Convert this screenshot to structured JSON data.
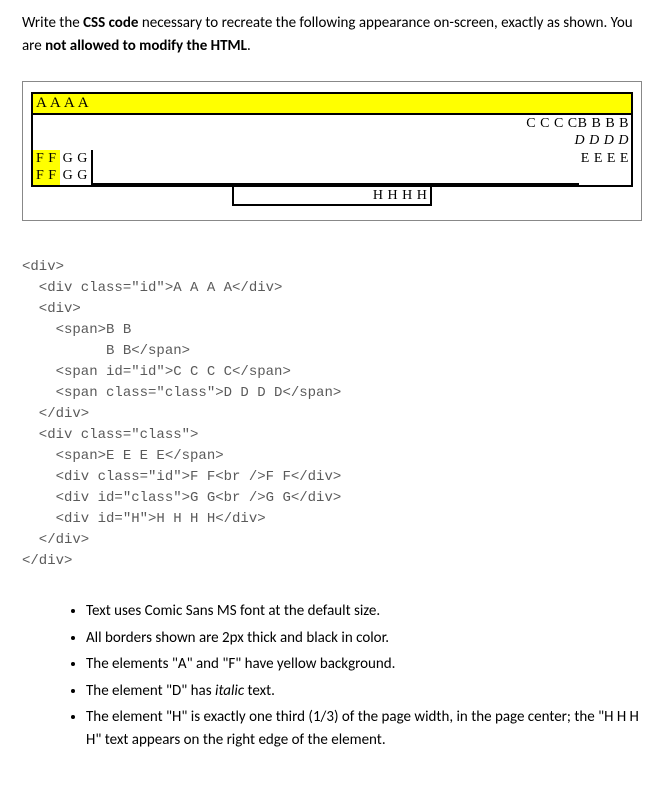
{
  "intro": {
    "part1": "Write the ",
    "bold1": "CSS code",
    "part2": " necessary to recreate the following appearance on-screen, exactly as shown. You are ",
    "bold2": "not allowed to modify the HTML",
    "part3": "."
  },
  "figure": {
    "a": "A A A A",
    "cccc": "C C C C",
    "bbbb": "B B B B",
    "dddd": "D D D D",
    "ff1": "F F",
    "ff2": "F F",
    "gg1": "G G",
    "gg2": "G G",
    "eeee": "E E E E",
    "hhhh": "H H H H"
  },
  "html_code": "<div>\n  <div class=\"id\">A A A A</div>\n  <div>\n    <span>B B\n          B B</span>\n    <span id=\"id\">C C C C</span>\n    <span class=\"class\">D D D D</span>\n  </div>\n  <div class=\"class\">\n    <span>E E E E</span>\n    <div class=\"id\">F F<br />F F</div>\n    <div id=\"class\">G G<br />G G</div>\n    <div id=\"H\">H H H H</div>\n  </div>\n</div>",
  "bullets": {
    "b1": "Text uses Comic Sans MS font at the default size.",
    "b2": "All borders shown are 2px thick and black in color.",
    "b3": "The elements \"A\" and \"F\" have yellow background.",
    "b4_pre": "The element \"D\" has ",
    "b4_i": "italic",
    "b4_post": " text.",
    "b5": "The element \"H\" is exactly one third (1/3) of the page width, in the page center; the \"H H H H\" text appears on the right edge of the element."
  }
}
